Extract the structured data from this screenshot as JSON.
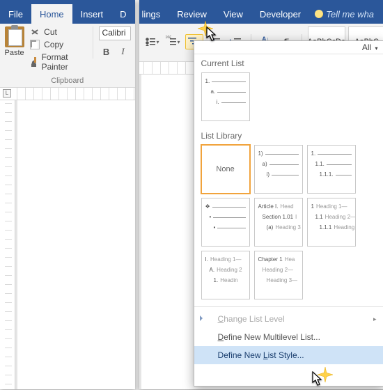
{
  "tabs_left": {
    "file": "File",
    "home": "Home",
    "insert": "Insert",
    "design_partial": "D"
  },
  "tabs_right": {
    "ings_partial": "lings",
    "review": "Review",
    "view": "View",
    "developer": "Developer",
    "tell_me": "Tell me wha"
  },
  "clipboard": {
    "paste": "Paste",
    "cut": "Cut",
    "copy": "Copy",
    "format_painter": "Format Painter",
    "group": "Clipboard"
  },
  "font": {
    "name": "Calibri",
    "bold": "B",
    "italic": "I"
  },
  "ruler_tab": "L",
  "styles": {
    "box1": "AaBbCcDc",
    "box2": "AaBbC"
  },
  "gallery": {
    "all": "All",
    "current_list": "Current List",
    "list_library": "List Library",
    "none": "None",
    "current_thumb": {
      "l1": "1.",
      "l2": "a.",
      "l3": "i."
    },
    "lib": [
      {
        "type": "none"
      },
      {
        "l1": "1)",
        "l2": "a)",
        "l3": "i)"
      },
      {
        "l1": "1.",
        "l2": "1.1.",
        "l3": "1.1.1."
      },
      {
        "l1": "❖",
        "l2": "•",
        "l3": "▪"
      },
      {
        "l1": "Article I.",
        "s1": "Head",
        "l2": "Section 1.01",
        "s2": "I",
        "l3": "(a)",
        "s3": "Heading 3"
      },
      {
        "l1": "1",
        "s1": "Heading 1—",
        "l2": "1.1",
        "s2": "Heading 2—",
        "l3": "1.1.1",
        "s3": "Heading 3—"
      },
      {
        "l1": "I.",
        "s1": "Heading 1—",
        "l2": "A.",
        "s2": "Heading 2",
        "l3": "1.",
        "s3": "Headin"
      },
      {
        "l1": "Chapter 1",
        "s1": "Hea",
        "l2": "",
        "s2": "Heading 2—",
        "l3": "",
        "s3": "Heading 3—"
      }
    ],
    "menu": {
      "change_level": "Change List Level",
      "define_multilevel": "Define New Multilevel List...",
      "define_style": "Define New List Style..."
    }
  }
}
